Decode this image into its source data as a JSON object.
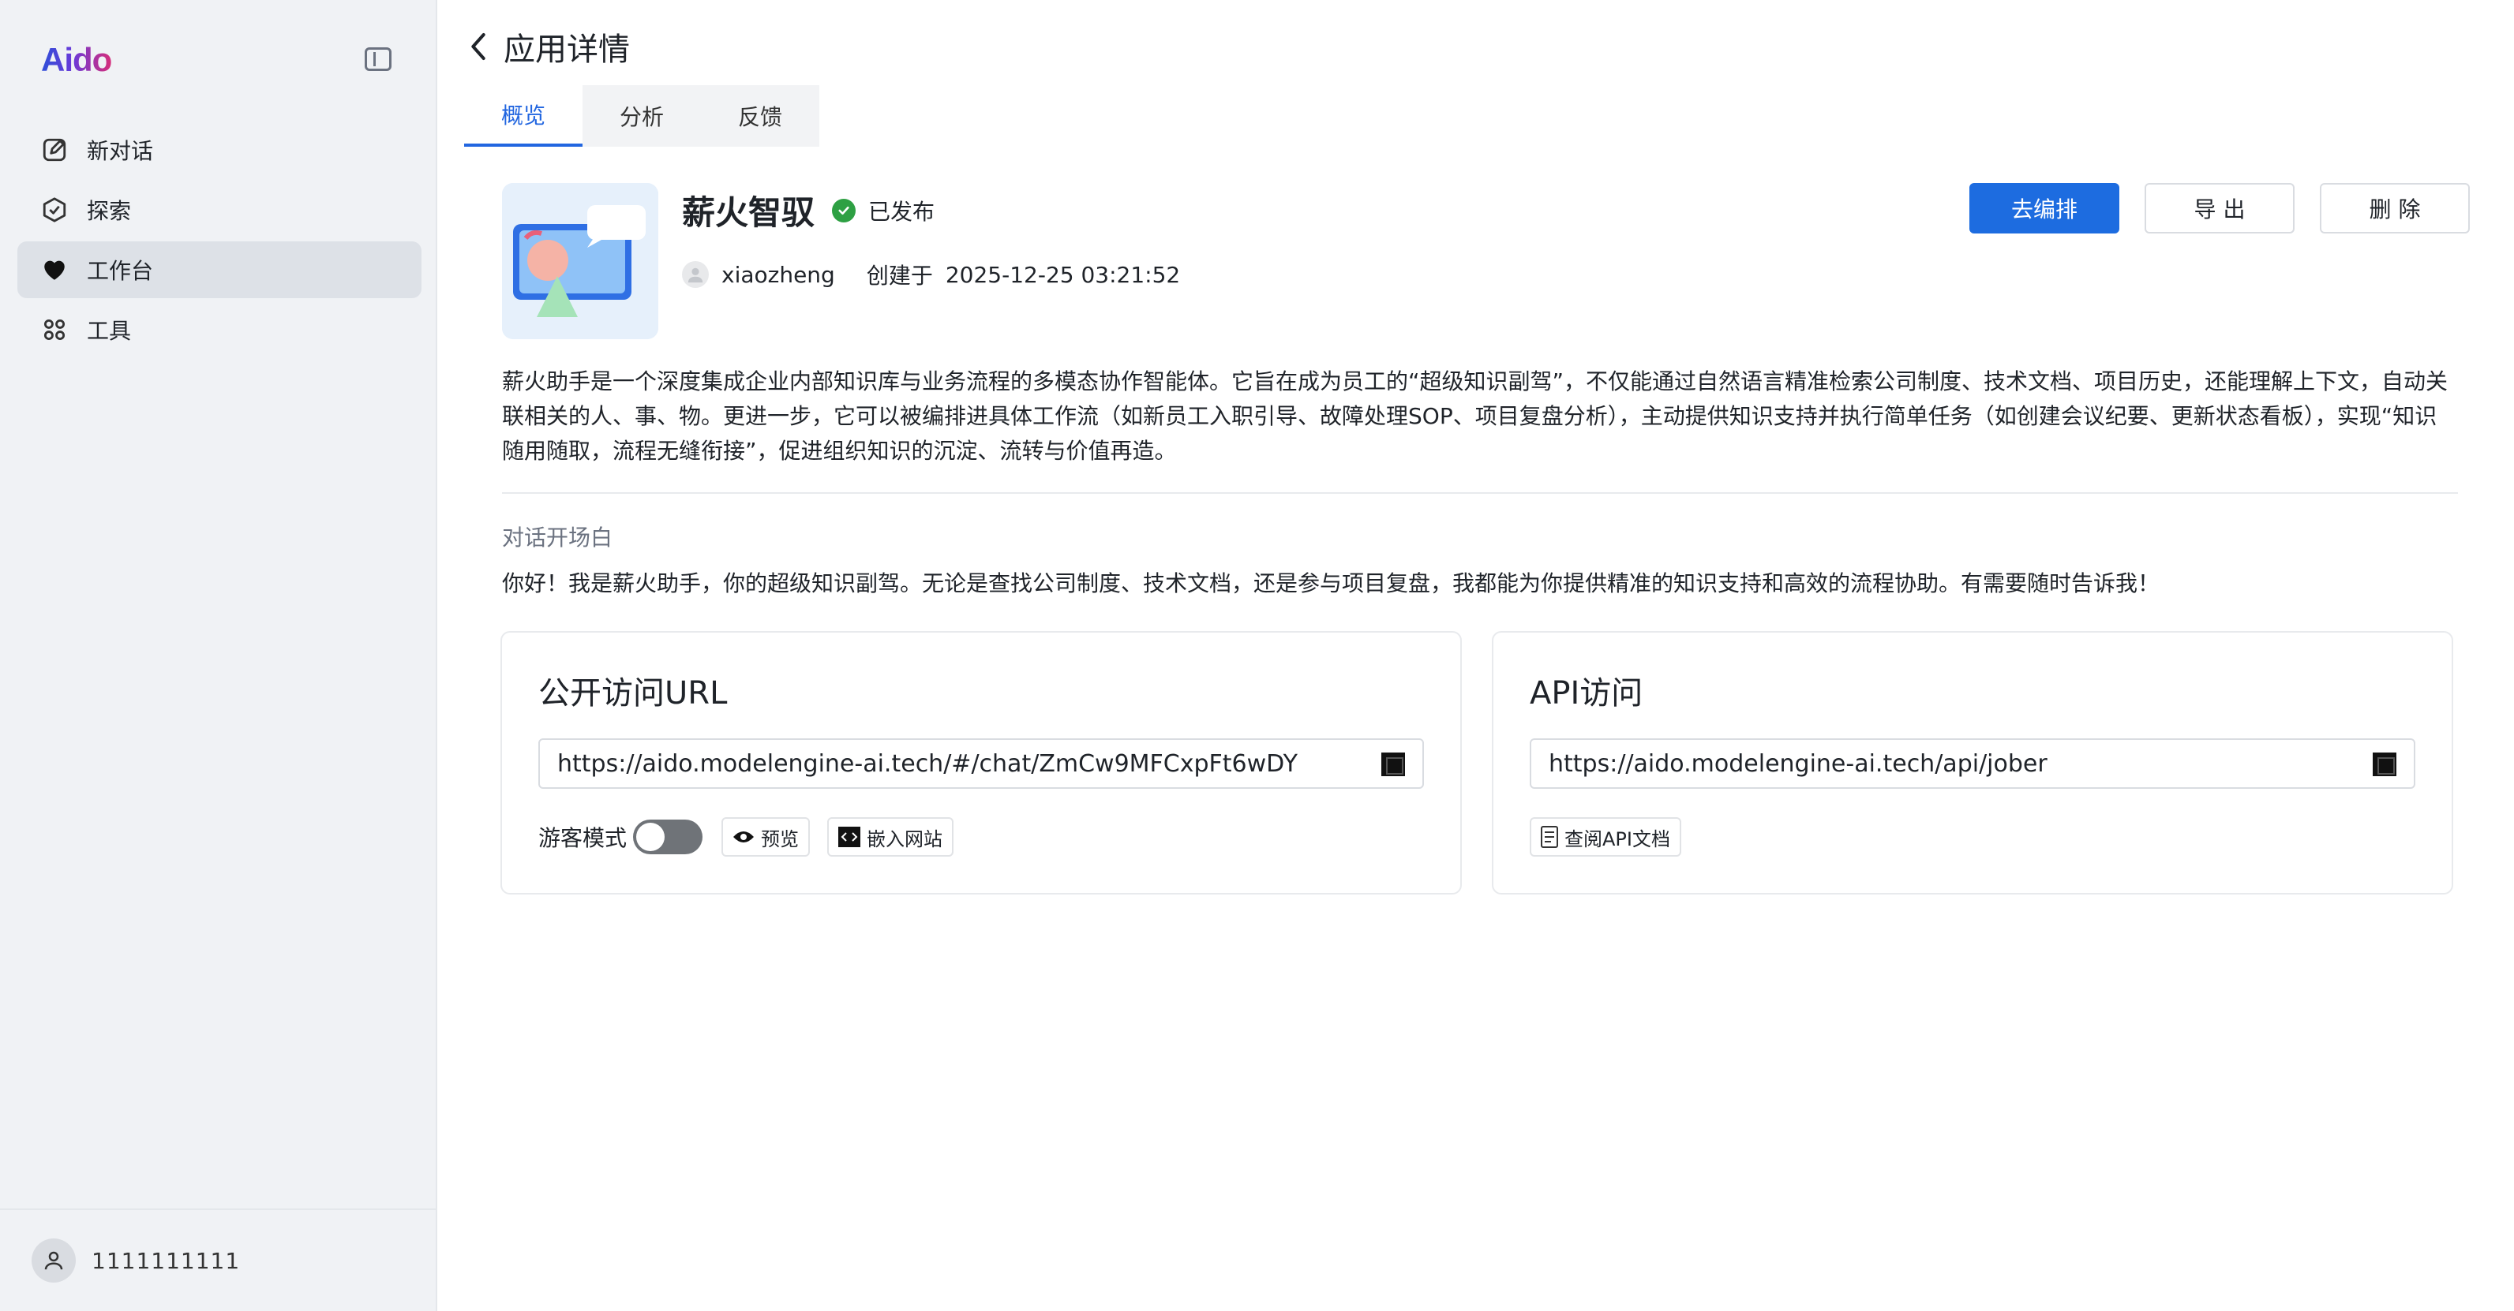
{
  "sidebar": {
    "logo": "Aido",
    "items": [
      {
        "label": "新对话",
        "icon": "edit-icon"
      },
      {
        "label": "探索",
        "icon": "explore-icon"
      },
      {
        "label": "工作台",
        "icon": "heart-icon",
        "active": true
      },
      {
        "label": "工具",
        "icon": "apps-grid-icon"
      }
    ],
    "user": {
      "name": "1111111111"
    }
  },
  "header": {
    "title": "应用详情",
    "tabs": [
      {
        "label": "概览",
        "active": true
      },
      {
        "label": "分析"
      },
      {
        "label": "反馈"
      }
    ]
  },
  "app": {
    "name": "薪火智驭",
    "status": "已发布",
    "author": "xiaozheng",
    "created_label": "创建于",
    "created_at": "2025-12-25 03:21:52",
    "description": "薪火助手是一个深度集成企业内部知识库与业务流程的多模态协作智能体。它旨在成为员工的“超级知识副驾”，不仅能通过自然语言精准检索公司制度、技术文档、项目历史，还能理解上下文，自动关联相关的人、事、物。更进一步，它可以被编排进具体工作流（如新员工入职引导、故障处理SOP、项目复盘分析），主动提供知识支持并执行简单任务（如创建会议纪要、更新状态看板），实现“知识随用随取，流程无缝衔接”，促进组织知识的沉淀、流转与价值再造。",
    "opening_label": "对话开场白",
    "opening_text": "你好！我是薪火助手，你的超级知识副驾。无论是查找公司制度、技术文档，还是参与项目复盘，我都能为你提供精准的知识支持和高效的流程协助。有需要随时告诉我！"
  },
  "actions": {
    "edit": "去编排",
    "export": "导 出",
    "delete": "删 除"
  },
  "public_card": {
    "title": "公开访问URL",
    "url": "https://aido.modelengine-ai.tech/#/chat/ZmCw9MFCxpFt6wDY",
    "guest_mode_label": "游客模式",
    "guest_mode_on": false,
    "preview": "预览",
    "embed": "嵌入网站"
  },
  "api_card": {
    "title": "API访问",
    "url": "https://aido.modelengine-ai.tech/api/jober",
    "docs": "查阅API文档"
  },
  "colors": {
    "primary": "#1d6ce0",
    "published": "#2ea043",
    "sidebar_bg": "#f0f2f5"
  }
}
